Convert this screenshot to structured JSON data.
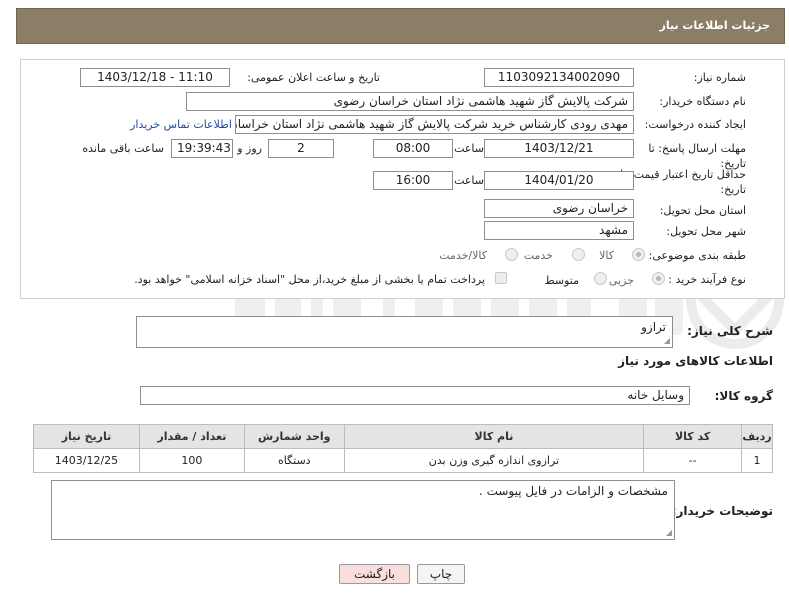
{
  "header": {
    "title": "جزئیات اطلاعات نیاز"
  },
  "form": {
    "need_number_label": "شماره نیاز:",
    "need_number": "1103092134002090",
    "announce_datetime_label": "تاریخ و ساعت اعلان عمومی:",
    "announce_datetime": "1403/12/18 - 11:10",
    "buyer_org_label": "نام دستگاه خریدار:",
    "buyer_org": "شرکت پالایش گاز شهید هاشمی نژاد   استان خراسان رضوی",
    "requester_label": "ایجاد کننده درخواست:",
    "requester": "مهدی رودی کارشناس خرید شرکت پالایش گاز شهید هاشمی نژاد   استان خراسان رضوی",
    "contact_link": "اطلاعات تماس خریدار",
    "reply_deadline_label": "مهلت ارسال پاسخ: تا تاریخ:",
    "reply_date": "1403/12/21",
    "time_label": "ساعت",
    "reply_time": "08:00",
    "days_value": "2",
    "days_label": "روز و",
    "remaining_time": "19:39:43",
    "remaining_label": "ساعت باقی مانده",
    "price_validity_label": "حداقل تاریخ اعتبار قیمت: تا تاریخ:",
    "validity_date": "1404/01/20",
    "validity_time": "16:00",
    "delivery_province_label": "استان محل تحویل:",
    "delivery_province": "خراسان رضوی",
    "delivery_city_label": "شهر محل تحویل:",
    "delivery_city": "مشهد",
    "category_label": "طبقه بندی موضوعی:",
    "category_options": [
      "کالا",
      "خدمت",
      "کالا/خدمت"
    ],
    "purchase_type_label": "نوع فرآیند خرید :",
    "purchase_options": [
      "جزیی",
      "متوسط"
    ],
    "payment_note": "پرداخت تمام یا بخشی از مبلغ خرید،از محل \"اسناد خزانه اسلامی\" خواهد بود."
  },
  "description": {
    "label": "شرح کلی نیاز:",
    "value": "ترازو"
  },
  "goods_section": {
    "title": "اطلاعات کالاهای مورد نیاز",
    "group_label": "گروه کالا:",
    "group_value": "وسایل خانه"
  },
  "table": {
    "headers": [
      "ردیف",
      "کد کالا",
      "نام کالا",
      "واحد شمارش",
      "تعداد / مقدار",
      "تاریخ نیاز"
    ],
    "rows": [
      [
        "1",
        "--",
        "ترازوی اندازه گیری وزن بدن",
        "دستگاه",
        "100",
        "1403/12/25"
      ]
    ]
  },
  "buyer_notes": {
    "label": "توضیحات خریدار:",
    "value": "مشخصات و الزامات در فایل پیوست ."
  },
  "buttons": {
    "print": "چاپ",
    "back": "بازگشت"
  },
  "colors": {
    "header_bg": "#8b7e66",
    "link": "#1b4fa0",
    "back_button_bg": "#f9dede"
  }
}
